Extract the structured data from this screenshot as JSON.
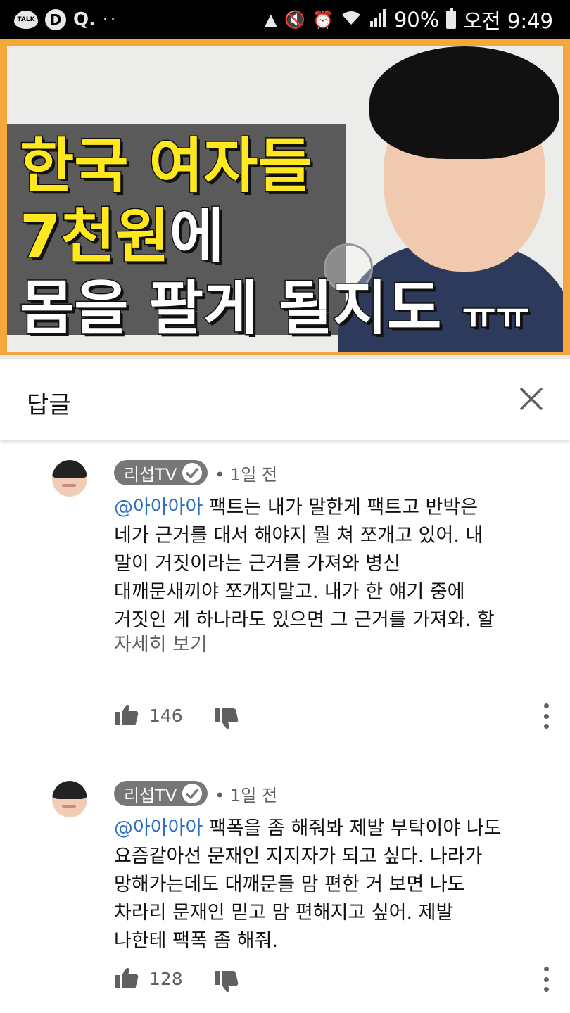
{
  "status_bar": {
    "talk_label": "TALK",
    "app2_glyph": "D",
    "app3_glyph": "Q.",
    "more_glyph": "··",
    "battery": "90%",
    "time": "오전 9:49",
    "icons": [
      "notification-icon",
      "mute-icon",
      "alarm-icon",
      "wifi-icon",
      "signal-icon",
      "battery-icon"
    ]
  },
  "video": {
    "headline_line1": "한국 여자들",
    "headline_line2_yellow": "7천원",
    "headline_line2_white": "에",
    "headline_line3": "몸을 팔게 될지도",
    "headline_line3_suffix": "ㅠㅠ",
    "progress_fraction": 0.0
  },
  "replies": {
    "title": "답글",
    "close_icon": "close-icon"
  },
  "comments": [
    {
      "author": "리섭TV",
      "time": "• 1일 전",
      "mention": "@아아아아",
      "text": " 팩트는 내가 말한게 팩트고 반박은\n네가 근거를 대서 해야지 뭘 쳐 쪼개고 있어. 내\n말이 거짓이라는 근거를 가져와 병신\n대깨문새끼야 쪼개지말고. 내가 한 얘기 중에\n거짓인 게 하나라도 있으면 그 근거를 가져와. 할",
      "more": "자세히 보기",
      "likes": "146"
    },
    {
      "author": "리섭TV",
      "time": "• 1일 전",
      "mention": "@아아아아",
      "text": " 팩폭을 좀 해줘봐 제발 부탁이야 나도\n요즘같아선 문재인 지지자가 되고 싶다. 나라가\n망해가는데도 대깨문들 맘 편한 거 보면 나도\n차라리 문재인 믿고 맘 편해지고 싶어. 제발\n나한테 팩폭 좀 해줘.",
      "more": "",
      "likes": "128"
    }
  ],
  "colors": {
    "accent_orange": "#f4a73a",
    "headline_yellow": "#ffe91e",
    "mention_blue": "#2f6fbf",
    "progress_red": "#e52d27"
  }
}
